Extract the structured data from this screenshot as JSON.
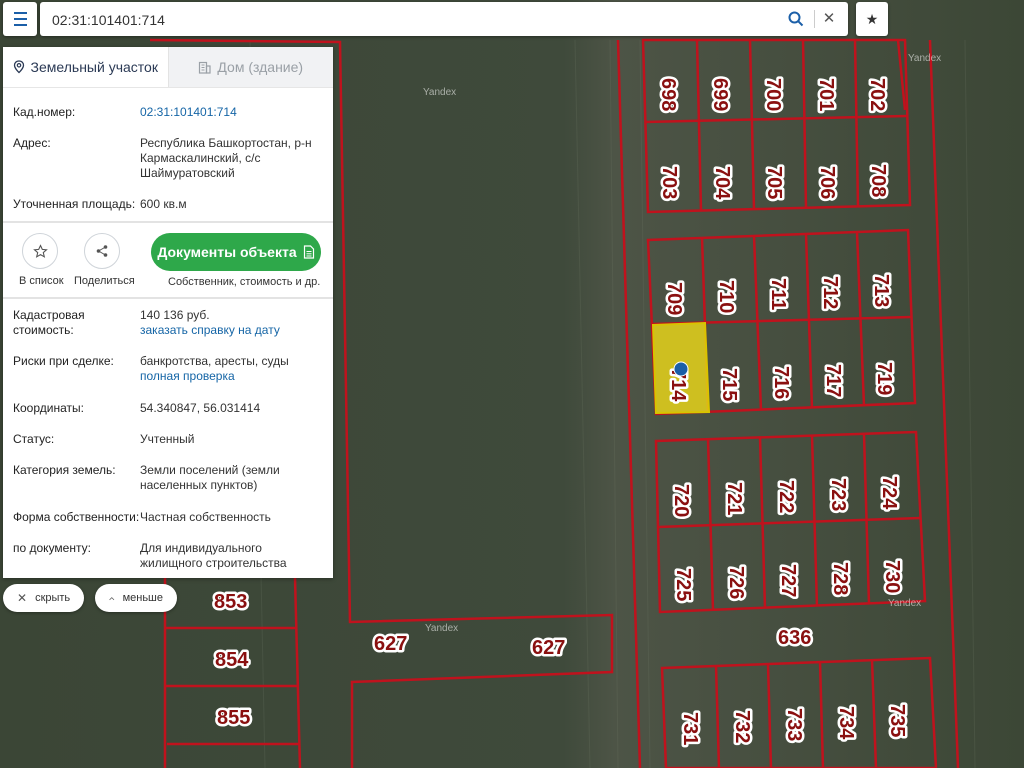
{
  "search": {
    "value": "02:31:101401:714",
    "placeholder": ""
  },
  "icons": {
    "menu": "hamburger-menu-icon",
    "search": "magnifier-icon",
    "clear": "close-icon",
    "favorite": "star-icon",
    "parcel": "map-pin-icon",
    "building": "building-icon",
    "list": "star-outline-icon",
    "share": "share-icon",
    "document": "document-icon",
    "hide": "close-icon",
    "less": "chevron-up-icon"
  },
  "tabs": [
    {
      "label": "Земельный участок"
    },
    {
      "label": "Дом (здание)"
    }
  ],
  "info": {
    "cad_number_label": "Кад.номер:",
    "cad_number_value": "02:31:101401:714",
    "address_label": "Адрес:",
    "address_value": "Республика Башкортостан, р-н Кармаскалинский, с/с Шаймуратовский",
    "area_label": "Уточненная площадь:",
    "area_value": "600 кв.м"
  },
  "actions": {
    "add_to_list": "В список",
    "share": "Поделиться",
    "documents": "Документы объекта",
    "documents_sub": "Собственник, стоимость и др."
  },
  "details": {
    "cost_label": "Кадастровая стоимость:",
    "cost_value": "140 136 руб.",
    "cost_link": "заказать справку на дату",
    "risk_label": "Риски при сделке:",
    "risk_value": "банкротства, аресты, суды",
    "risk_link": "полная проверка",
    "coords_label": "Координаты:",
    "coords_value": "54.340847, 56.031414",
    "status_label": "Статус:",
    "status_value": "Учтенный",
    "category_label": "Категория земель:",
    "category_value": "Земли поселений (земли населенных пунктов)",
    "ownership_label": "Форма собственности:",
    "ownership_value": "Частная собственность",
    "by_doc_label": "по документу:",
    "by_doc_value": "Для индивидуального жилищного строительства"
  },
  "controls": {
    "hide": "скрыть",
    "less": "меньше"
  },
  "map": {
    "watermark": "Yandex",
    "selected_plot": "714",
    "plots": [
      "698",
      "699",
      "700",
      "701",
      "702",
      "703",
      "704",
      "705",
      "706",
      "708",
      "709",
      "710",
      "711",
      "712",
      "713",
      "714",
      "715",
      "716",
      "717",
      "719",
      "720",
      "721",
      "722",
      "723",
      "724",
      "725",
      "726",
      "727",
      "728",
      "730",
      "636",
      "627",
      "627",
      "731",
      "732",
      "733",
      "734",
      "735",
      "853",
      "854",
      "855"
    ],
    "colors": {
      "boundary": "#c0121d",
      "selected_fill": "#e5d21a",
      "label_text": "#8a1010",
      "marker": "#1b5fa8",
      "docs_button": "#2ea84a",
      "link": "#1565a6"
    }
  }
}
